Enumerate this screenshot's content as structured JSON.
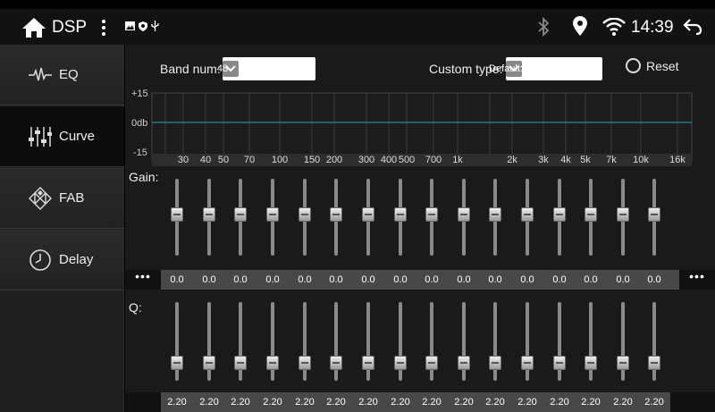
{
  "statusbar": {
    "title": "DSP",
    "time": "14:39",
    "icons": [
      "home-icon",
      "more-vert-icon",
      "image-icon",
      "shield-icon",
      "usb-icon",
      "bluetooth-icon",
      "location-icon",
      "wifi-icon",
      "back-icon"
    ]
  },
  "sidebar": {
    "items": [
      {
        "label": "EQ",
        "icon": "waveform-icon"
      },
      {
        "label": "Curve",
        "icon": "sliders-icon",
        "active": true
      },
      {
        "label": "FAB",
        "icon": "speaker-balance-icon"
      },
      {
        "label": "Delay",
        "icon": "clock-icon"
      }
    ]
  },
  "controls": {
    "band_label": "Band num:",
    "band_value": "48",
    "custom_label": "Custom type:",
    "custom_value": "Default:",
    "reset_label": "Reset"
  },
  "graph": {
    "y_labels": [
      "+15",
      "0db",
      "-15"
    ],
    "freq_labels": [
      "30",
      "40",
      "50",
      "70",
      "100",
      "150",
      "200",
      "300",
      "400",
      "500",
      "700",
      "1k",
      "2k",
      "3k",
      "4k",
      "5k",
      "7k",
      "10k",
      "16k"
    ]
  },
  "gain": {
    "label": "Gain:",
    "more": "•••",
    "values": [
      "0.0",
      "0.0",
      "0.0",
      "0.0",
      "0.0",
      "0.0",
      "0.0",
      "0.0",
      "0.0",
      "0.0",
      "0.0",
      "0.0",
      "0.0",
      "0.0",
      "0.0",
      "0.0"
    ]
  },
  "q": {
    "label": "Q:",
    "values": [
      "2.20",
      "2.20",
      "2.20",
      "2.20",
      "2.20",
      "2.20",
      "2.20",
      "2.20",
      "2.20",
      "2.20",
      "2.20",
      "2.20",
      "2.20",
      "2.20",
      "2.20",
      "2.20"
    ]
  },
  "colors": {
    "curve_line": "#2a8a9a",
    "accent": "#ffffff"
  }
}
